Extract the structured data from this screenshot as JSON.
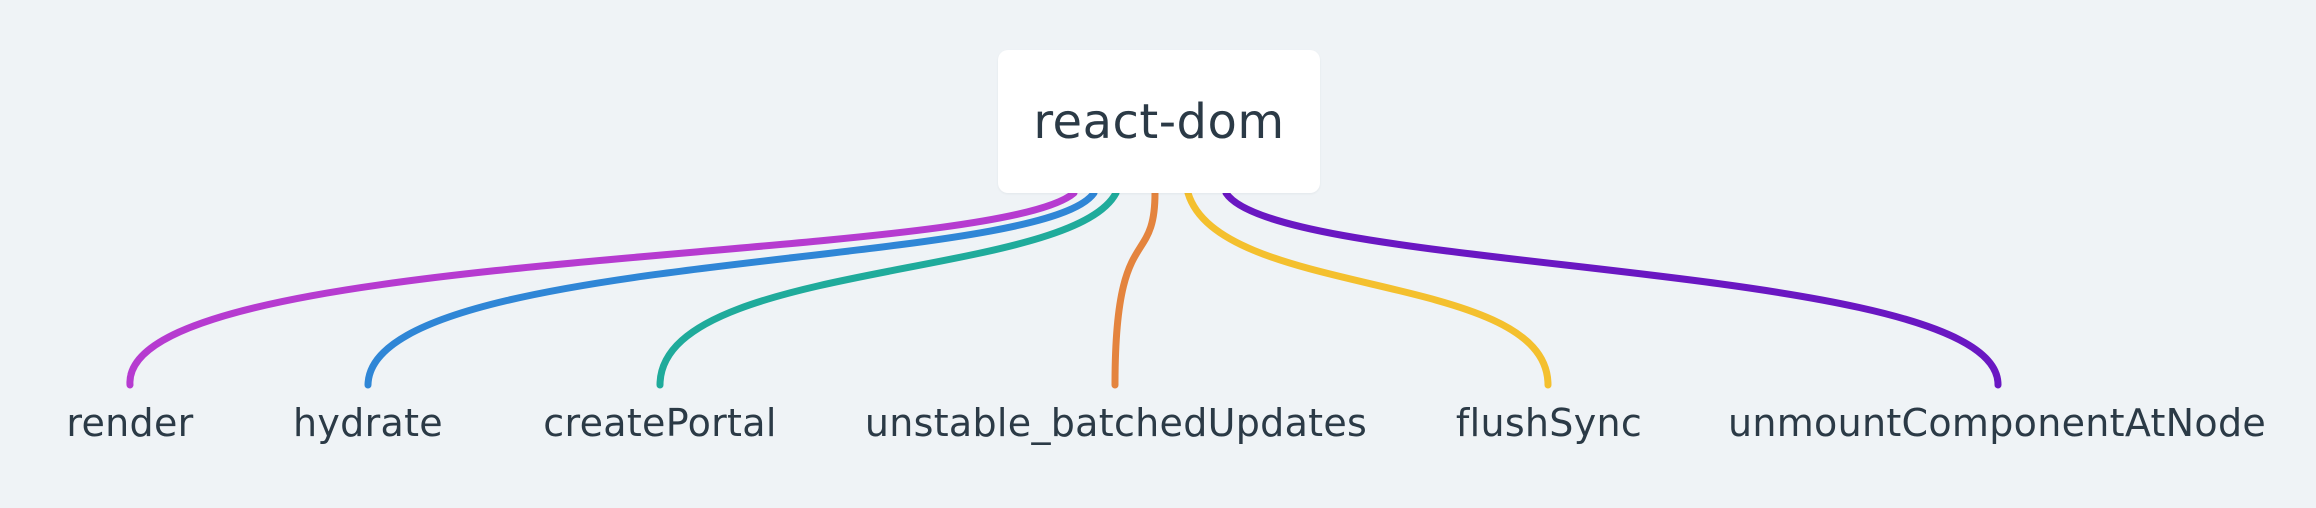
{
  "root": {
    "label": "react-dom"
  },
  "children": [
    {
      "label": "render",
      "color": "#b63bd0"
    },
    {
      "label": "hydrate",
      "color": "#2f86d6"
    },
    {
      "label": "createPortal",
      "color": "#1fab9b"
    },
    {
      "label": "unstable_batchedUpdates",
      "color": "#e4843e"
    },
    {
      "label": "flushSync",
      "color": "#f4c02e"
    },
    {
      "label": "unmountComponentAtNode",
      "color": "#6a17c2"
    }
  ]
}
